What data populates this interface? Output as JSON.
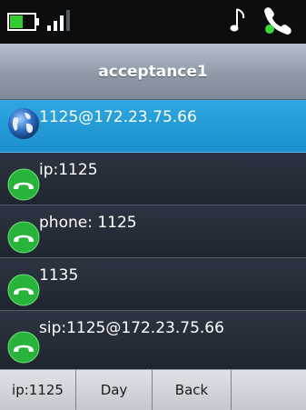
{
  "status_bar": {
    "icons": [
      "battery-icon",
      "signal-icon",
      "music-note-icon",
      "handset-icon"
    ]
  },
  "header": {
    "title": "acceptance1"
  },
  "list": {
    "items": [
      {
        "label": "1125@172.23.75.66",
        "icon": "globe-icon",
        "selected": true
      },
      {
        "label": "ip:1125",
        "icon": "phone-handset-icon",
        "selected": false
      },
      {
        "label": "phone: 1125",
        "icon": "phone-handset-icon",
        "selected": false
      },
      {
        "label": "1135",
        "icon": "phone-handset-icon",
        "selected": false
      },
      {
        "label": "sip:1125@172.23.75.66",
        "icon": "phone-handset-icon",
        "selected": false
      }
    ]
  },
  "softkeys": [
    "ip:1125",
    "Day",
    "Back",
    ""
  ],
  "colors": {
    "selected_row": "#1f9ad6",
    "row_background": "#252b35",
    "call_icon": "#28b43a",
    "status_icon_green": "#3bd640"
  }
}
